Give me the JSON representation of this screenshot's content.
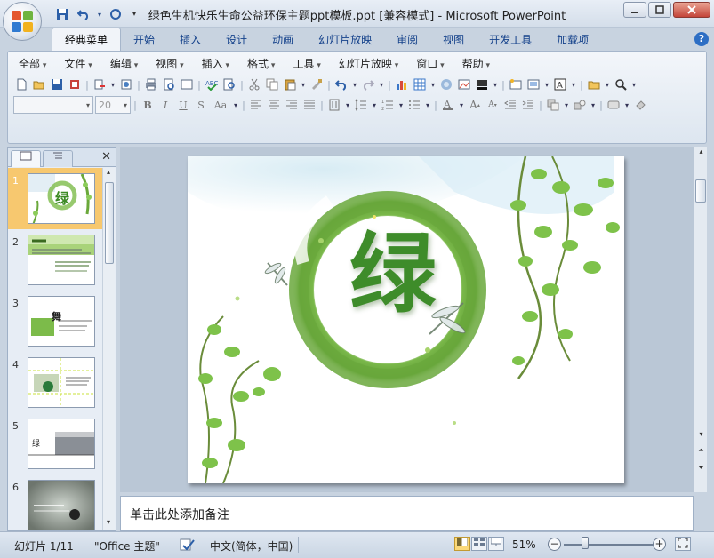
{
  "window": {
    "title": "绿色生机快乐生命公益环保主题ppt模板.ppt [兼容模式] - Microsoft PowerPoint"
  },
  "quick_access": {
    "icons": [
      "save-icon",
      "undo-icon",
      "redo-icon",
      "customize-icon"
    ]
  },
  "ribbon_tabs": [
    {
      "label": "经典菜单",
      "active": true
    },
    {
      "label": "开始"
    },
    {
      "label": "插入"
    },
    {
      "label": "设计"
    },
    {
      "label": "动画"
    },
    {
      "label": "幻灯片放映"
    },
    {
      "label": "审阅"
    },
    {
      "label": "视图"
    },
    {
      "label": "开发工具"
    },
    {
      "label": "加载项"
    }
  ],
  "classic_menu": [
    {
      "label": "全部"
    },
    {
      "label": "文件"
    },
    {
      "label": "编辑"
    },
    {
      "label": "视图"
    },
    {
      "label": "插入"
    },
    {
      "label": "格式"
    },
    {
      "label": "工具"
    },
    {
      "label": "幻灯片放映"
    },
    {
      "label": "窗口"
    },
    {
      "label": "帮助"
    }
  ],
  "format_bar": {
    "font_name": "",
    "font_size": "20",
    "bold": "B",
    "italic": "I",
    "underline": "U",
    "shadow": "S",
    "case": "Aa"
  },
  "slides_pane": {
    "slide_numbers": [
      "1",
      "2",
      "3",
      "4",
      "5",
      "6"
    ],
    "selected_index": 0,
    "thumb_texts": {
      "s1": "绿",
      "s3": "舞",
      "s5": "绿"
    }
  },
  "slide": {
    "main_char": "绿"
  },
  "notes": {
    "placeholder": "单击此处添加备注"
  },
  "status": {
    "slide_info": "幻灯片 1/11",
    "theme": "\"Office 主题\"",
    "language": "中文(简体，中国)",
    "zoom": "51%",
    "zoom_value": 51
  },
  "colors": {
    "accent_green": "#5c9a2f",
    "selected_thumb": "#f7c86f",
    "title_bar": "#dfe7f1"
  }
}
